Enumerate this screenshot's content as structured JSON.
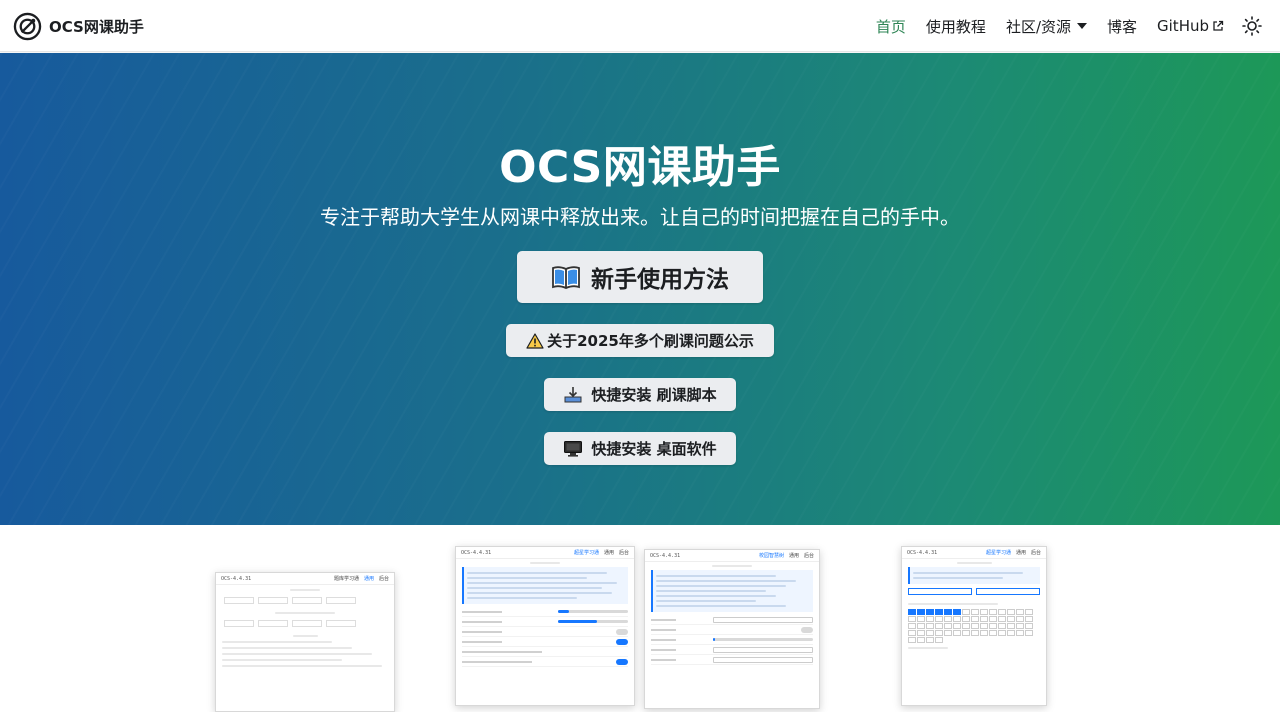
{
  "brand": {
    "title": "OCS网课助手",
    "logo_icon": "ocs-logo-icon"
  },
  "nav": {
    "home": "首页",
    "tutorial": "使用教程",
    "community": "社区/资源",
    "blog": "博客",
    "github": "GitHub",
    "active_color": "#2e8555"
  },
  "hero": {
    "title": "OCS网课助手",
    "subtitle": "专注于帮助大学生从网课中释放出来。让自己的时间把握在自己的手中。",
    "buttons": {
      "guide": "新手使用方法",
      "notice": "关于2025年多个刷课问题公示",
      "install_script": "快捷安装 刷课脚本",
      "install_desktop": "快捷安装 桌面软件"
    },
    "gradient": [
      "#175a9d",
      "#1d9858"
    ]
  },
  "previews": {
    "version": "OCS-4.4.31",
    "p1_tabs": [
      "题库学习通",
      "通用",
      "后台"
    ],
    "p2_tabs": [
      "超星学习通",
      "通用",
      "后台"
    ],
    "p3_tabs": [
      "校园智慧树",
      "通用",
      "后台"
    ],
    "p4_tabs": [
      "超星学习通",
      "通用",
      "后台"
    ]
  }
}
